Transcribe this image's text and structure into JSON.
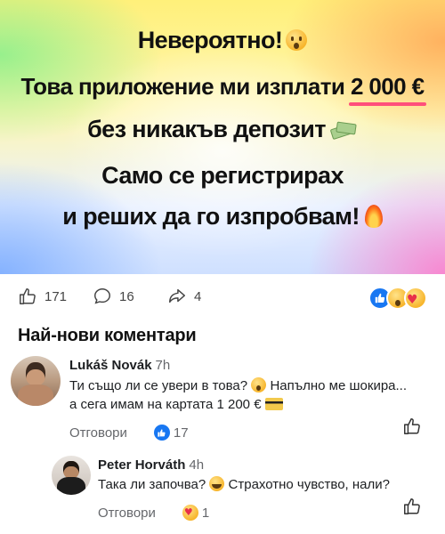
{
  "banner": {
    "line1": "Невероятно!",
    "line2_prefix": "Това приложение ми изплати",
    "line2_amount": "2 000 €",
    "line3": "без никакъв депозит",
    "line4": "Само се регистрирах",
    "line5": "и реших да го изпробвам!"
  },
  "stats": {
    "likes": "171",
    "comments": "16",
    "shares": "4"
  },
  "section_title": "Най-нови коментари",
  "comments": [
    {
      "author": "Lukáš Novák",
      "time": "7h",
      "text_part1": "Ти също ли се увери в това?",
      "text_part2": "Напълно ме шокира...",
      "text_part3": "а сега имам на картата 1 200 €",
      "reply_label": "Отговори",
      "reaction_count": "17"
    },
    {
      "author": "Peter Horváth",
      "time": "4h",
      "text_part1": "Така ли започва?",
      "text_part2": "Страхотно чувство, нали?",
      "reply_label": "Отговори",
      "reaction_count": "1"
    }
  ],
  "colors": {
    "accent": "#1877f2",
    "underline": "#ff4f7b",
    "muted": "#65676b"
  }
}
